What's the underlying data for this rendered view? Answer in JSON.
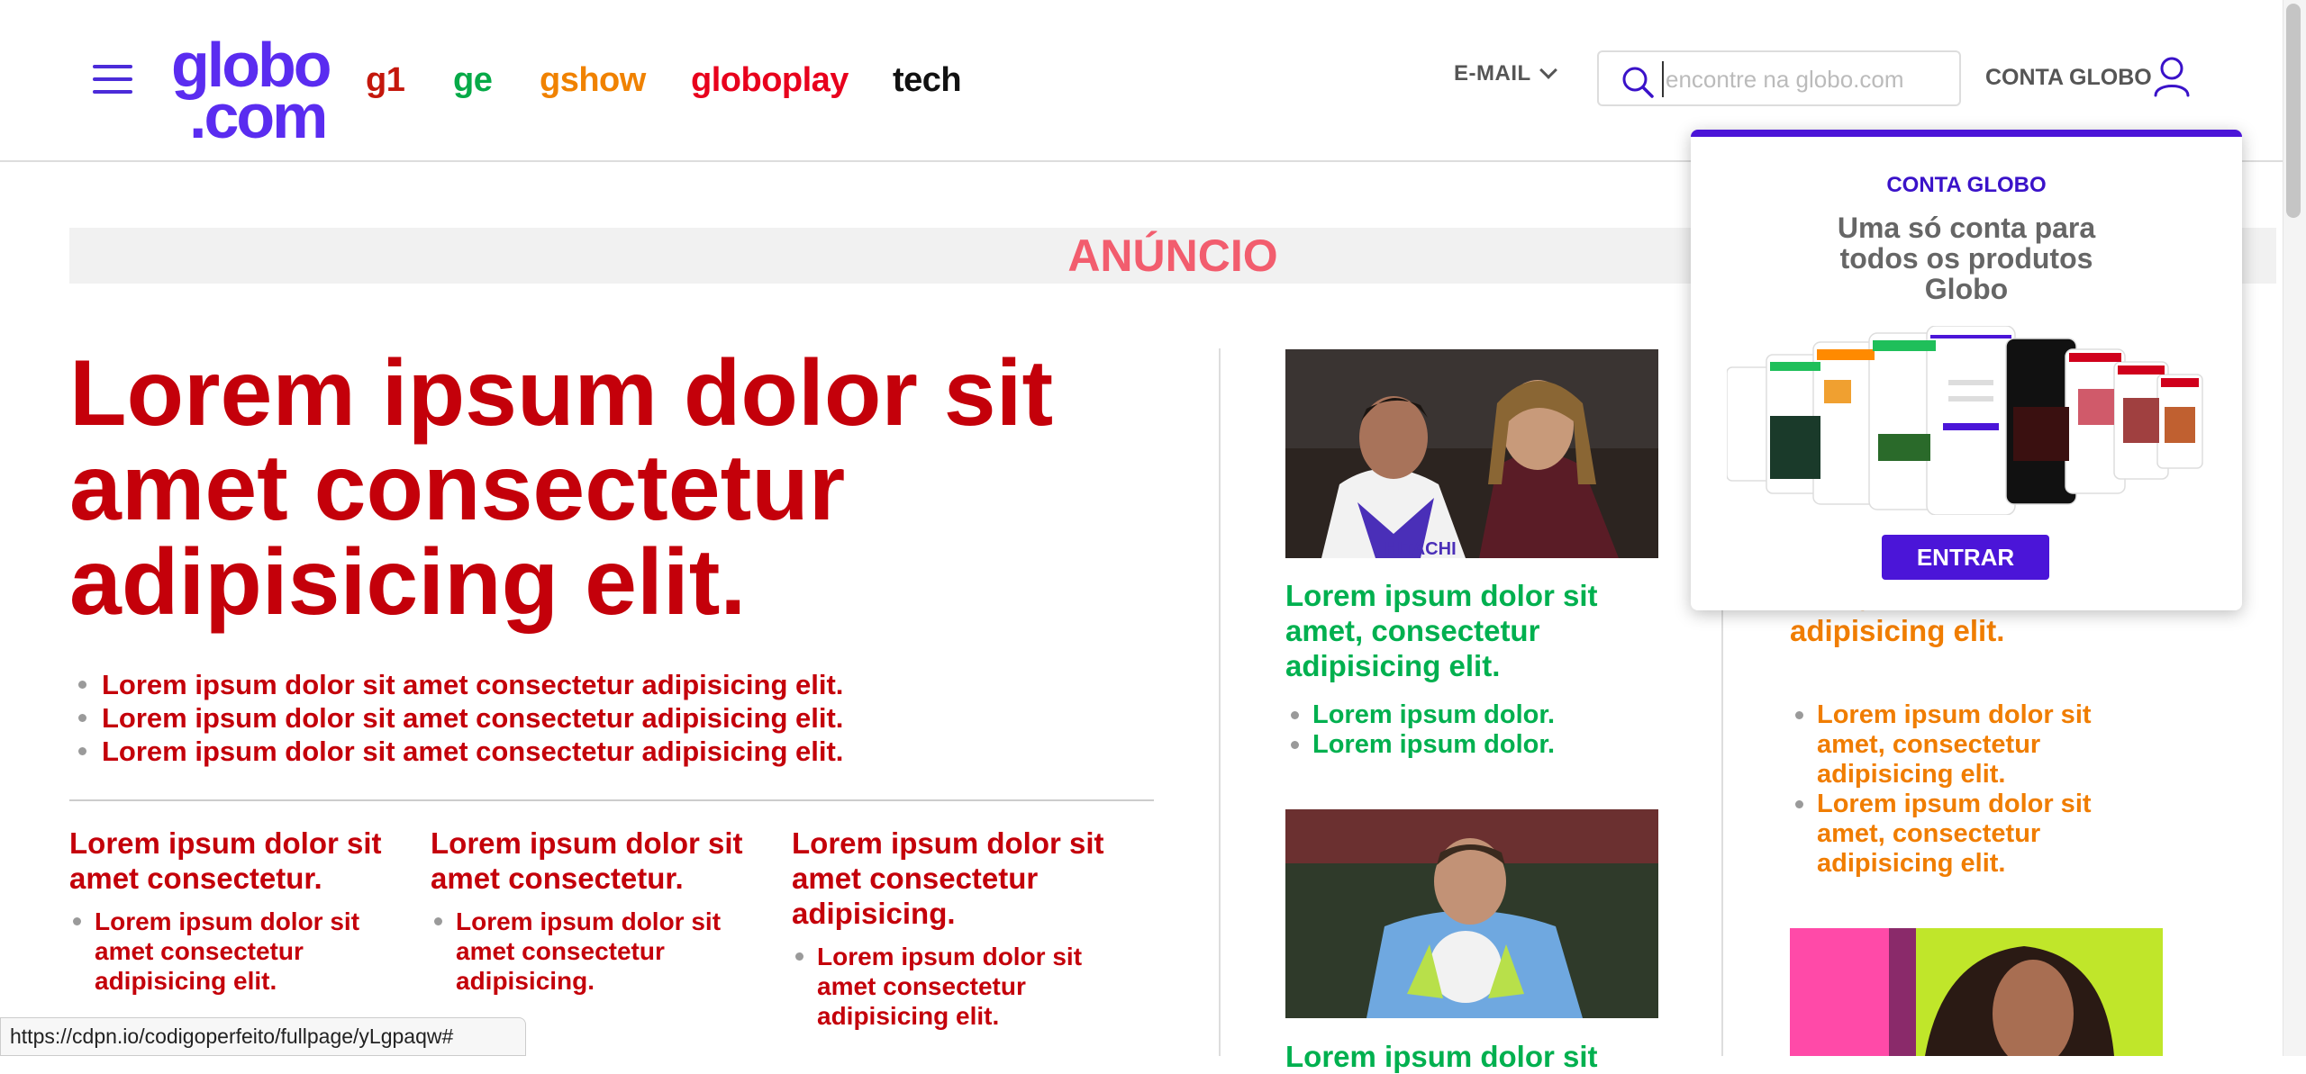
{
  "header": {
    "logo": {
      "line1": "globo",
      "line2": ".com"
    },
    "nav": [
      {
        "label": "g1",
        "color": "#c4170c"
      },
      {
        "label": "ge",
        "color": "#06aa48"
      },
      {
        "label": "gshow",
        "color": "#f08200"
      },
      {
        "label": "globoplay",
        "color": "#e8001c"
      },
      {
        "label": "tech",
        "color": "#111111"
      }
    ],
    "email_label": "E-MAIL",
    "search": {
      "placeholder": "encontre na globo.com",
      "value": ""
    },
    "account_label": "CONTA GLOBO"
  },
  "ad": {
    "label": "ANÚNCIO"
  },
  "main": {
    "title": "Lorem ipsum dolor sit amet consectetur adipisicing elit.",
    "bullets": [
      "Lorem ipsum dolor sit amet consectetur adipisicing elit.",
      "Lorem ipsum dolor sit amet consectetur adipisicing elit.",
      "Lorem ipsum dolor sit amet consectetur adipisicing elit."
    ],
    "subs": [
      {
        "title": "Lorem ipsum dolor sit amet consectetur.",
        "bullet": "Lorem ipsum dolor sit amet consectetur adipisicing elit."
      },
      {
        "title": "Lorem ipsum dolor sit amet consectetur.",
        "bullet": "Lorem ipsum dolor sit amet consectetur adipisicing."
      },
      {
        "title": "Lorem ipsum dolor sit amet consectetur adipisicing.",
        "bullet": "Lorem ipsum dolor sit amet consectetur adipisicing elit."
      }
    ]
  },
  "col2": {
    "title": "Lorem ipsum dolor sit amet, consectetur adipisicing elit.",
    "bullets": [
      "Lorem ipsum dolor.",
      "Lorem ipsum dolor."
    ],
    "title2": "Lorem ipsum dolor sit"
  },
  "col3": {
    "title": "amet, consectetur adipisicing elit.",
    "bullets": [
      "Lorem ipsum dolor sit amet, consectetur adipisicing elit.",
      "Lorem ipsum dolor sit amet, consectetur adipisicing elit."
    ]
  },
  "popup": {
    "label": "CONTA GLOBO",
    "text": "Uma só conta para todos os produtos Globo",
    "button": "ENTRAR"
  },
  "status_url": "https://cdpn.io/codigoperfeito/fullpage/yLgpaqw#",
  "colors": {
    "accent": "#4b15d8",
    "g1_red": "#c4000a",
    "ge_green": "#00b04f",
    "gshow_orange": "#f07d00"
  }
}
